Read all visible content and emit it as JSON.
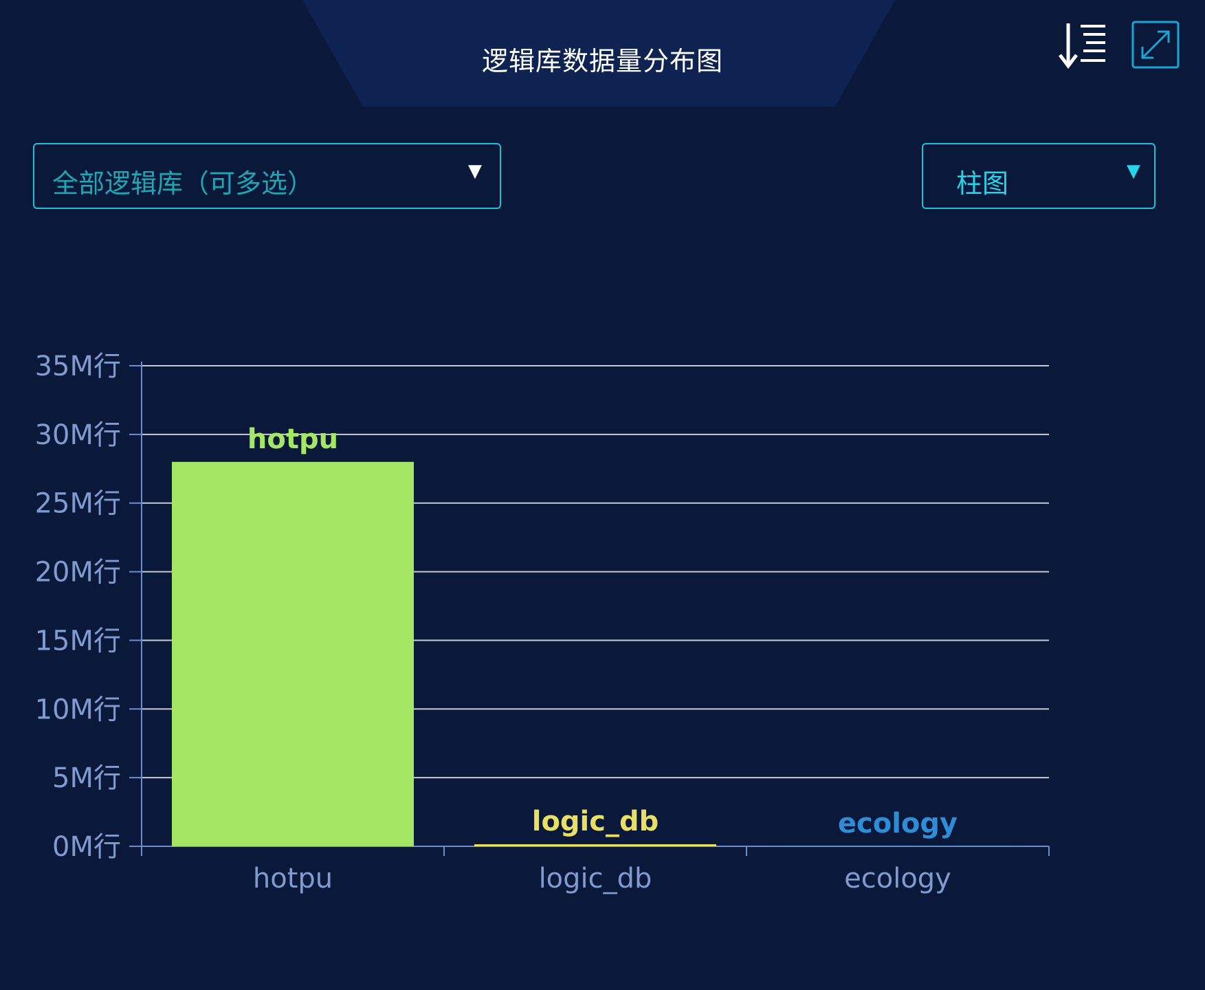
{
  "panel": {
    "title": "逻辑库数据量分布图"
  },
  "toolbar": {
    "sort_icon": "sort-descending-icon",
    "expand_icon": "expand-icon"
  },
  "filters": {
    "db_select": {
      "value": "全部逻辑库（可多选）",
      "caret": "▼"
    },
    "chart_type_select": {
      "value": "柱图",
      "caret": "▼"
    }
  },
  "colors": {
    "background": "#0a1839",
    "tab": "#0f2352",
    "accent": "#19c3d6",
    "axis": "#6a8fd1",
    "grid": "#c8cbd2",
    "tick_label": "#7f9bd0"
  },
  "chart_data": {
    "type": "bar",
    "categories": [
      "hotpu",
      "logic_db",
      "ecology"
    ],
    "values": [
      28000000,
      150000,
      10000
    ],
    "bar_colors": [
      "#a6e665",
      "#e8df63",
      "#2f8cd6"
    ],
    "yticks": [
      0,
      5000000,
      10000000,
      15000000,
      20000000,
      25000000,
      30000000,
      35000000
    ],
    "ytick_labels": [
      "0M行",
      "5M行",
      "10M行",
      "15M行",
      "20M行",
      "25M行",
      "30M行",
      "35M行"
    ],
    "ylim": [
      0,
      35000000
    ],
    "grid": true,
    "title": "",
    "xlabel": "",
    "ylabel": ""
  }
}
